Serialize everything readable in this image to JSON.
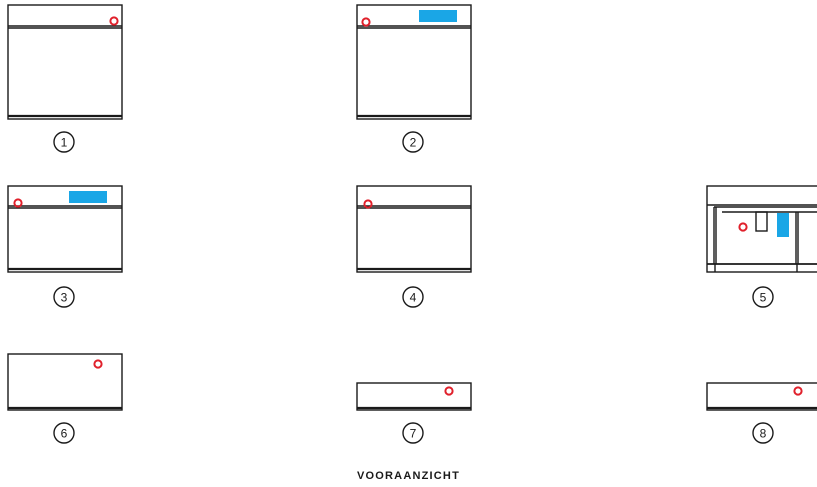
{
  "view_title": "VOORAANZICHT",
  "colors": {
    "stroke": "#1a1a1a",
    "indicator_ring": "#e0202b",
    "display_panel": "#1aa6e6",
    "background": "#ffffff"
  },
  "units": [
    {
      "number": "1",
      "has_display": false,
      "indicator_side": "right"
    },
    {
      "number": "2",
      "has_display": true,
      "indicator_side": "left"
    },
    {
      "number": "3",
      "has_display": true,
      "indicator_side": "left"
    },
    {
      "number": "4",
      "has_display": false,
      "indicator_side": "left"
    },
    {
      "number": "5",
      "has_display": true,
      "indicator_side": "left"
    },
    {
      "number": "6",
      "has_display": false,
      "indicator_side": "right"
    },
    {
      "number": "7",
      "has_display": false,
      "indicator_side": "right"
    },
    {
      "number": "8",
      "has_display": false,
      "indicator_side": "right"
    }
  ]
}
